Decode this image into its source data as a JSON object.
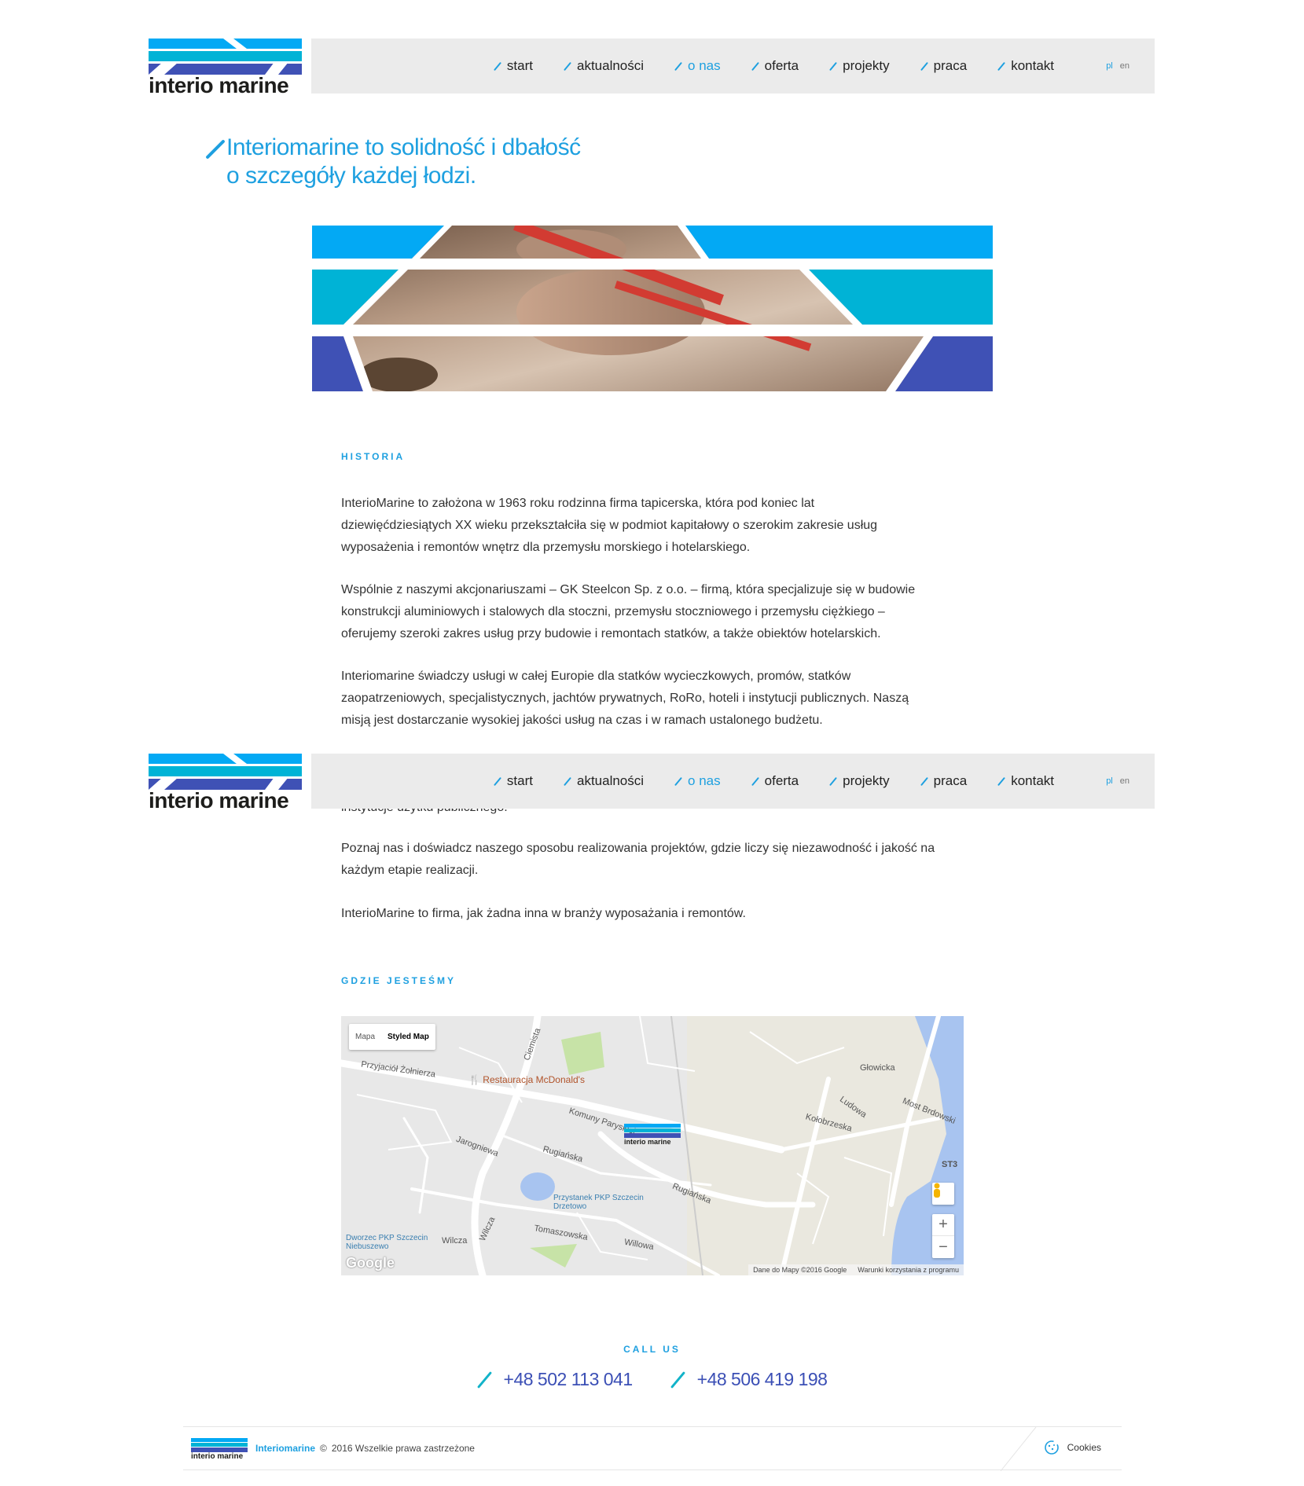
{
  "brand": {
    "logo_text": "interio marine",
    "colors": {
      "accent": "#1ea0e0",
      "cyan": "#00b3d6",
      "blue": "#3f51b5",
      "sky": "#03a9f4",
      "navbar_bg": "#ebebeb"
    }
  },
  "nav": {
    "items": [
      {
        "label": "start",
        "active": false
      },
      {
        "label": "aktualności",
        "active": false
      },
      {
        "label": "o nas",
        "active": true
      },
      {
        "label": "oferta",
        "active": false
      },
      {
        "label": "projekty",
        "active": false
      },
      {
        "label": "praca",
        "active": false
      },
      {
        "label": "kontakt",
        "active": false
      }
    ],
    "languages": [
      {
        "code": "pl",
        "active": true
      },
      {
        "code": "en",
        "active": false
      }
    ]
  },
  "hero": {
    "title_line1": "Interiomarine to solidność i dbałość",
    "title_line2": "o szczegóły każdej łodzi."
  },
  "historia": {
    "label": "HISTORIA",
    "p1": [
      "InterioMarine to założona w 1963 roku rodzinna firma tapicerska, która pod koniec lat",
      "dziewięćdziesiątych XX wieku przekształciła się w podmiot kapitałowy o szerokim zakresie usług",
      "wyposażenia i remontów wnętrz dla przemysłu morskiego i hotelarskiego."
    ],
    "p2": [
      "Wspólnie z naszymi akcjonariuszami – GK Steelcon Sp. z o.o. – firmą, która specjalizuje się w budowie",
      "konstrukcji aluminiowych i stalowych dla stoczni, przemysłu stoczniowego i przemysłu ciężkiego –",
      "oferujemy szeroki zakres usług przy budowie i remontach statków, a także obiektów hotelarskich."
    ],
    "p3": [
      "Interiomarine świadczy usługi w całej Europie dla statków wycieczkowych, promów, statków",
      "zaopatrzeniowych, specjalistycznych, jachtów prywatnych, RoRo, hoteli i instytucji publicznych. Naszą",
      "misją jest dostarczanie wysokiej jakości usług na czas i w ramach ustalonego budżetu."
    ],
    "p4_partial": "instytucje użytku publicznego.",
    "p5": [
      "Poznaj nas i doświadcz naszego sposobu realizowania projektów, gdzie liczy się niezawodność i jakość na",
      "każdym etapie realizacji."
    ],
    "p6": "InterioMarine to firma, jak żadna inna w branży wyposażania i remontów."
  },
  "location": {
    "label": "GDZIE JESTEŚMY",
    "map": {
      "type_buttons": [
        "Mapa",
        "Styled Map"
      ],
      "selected_type": "Styled Map",
      "streets": [
        "Przyjaciół Żołnierza",
        "Komuny Paryskiej",
        "Jarogniewa",
        "Rugiańska",
        "Rugiańska",
        "Wilcza",
        "Wilcza",
        "Tomaszowska",
        "Willowa",
        "Ciemista",
        "Głowicka",
        "Ludowa",
        "Kołobrzeska",
        "Most Brdowski",
        "ST3"
      ],
      "poi": "Restauracja McDonald's",
      "stations": [
        "Przystanek PKP Szczecin Drzetowo",
        "Dworzec PKP Szczecin Niebuszewo"
      ],
      "marker_text": "interio marine",
      "google": "Google",
      "attribution": "Dane do Mapy ©2016 Google",
      "terms": "Warunki korzystania z programu",
      "zoom_in": "+",
      "zoom_out": "−"
    }
  },
  "call": {
    "label": "CALL US",
    "phones": [
      "+48 502 113 041",
      "+48 506 419 198"
    ]
  },
  "footer": {
    "brand": "Interiomarine",
    "copyright_symbol": "©",
    "copyright_text": "2016 Wszelkie prawa zastrzeżone",
    "cookies": "Cookies"
  }
}
